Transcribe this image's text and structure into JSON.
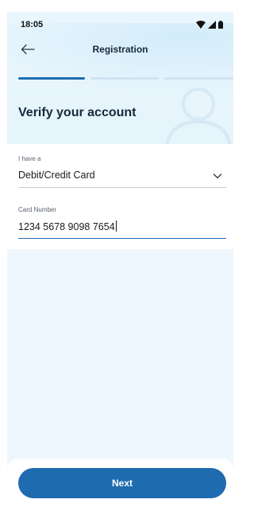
{
  "status_bar": {
    "time": "18:05"
  },
  "header": {
    "title": "Registration"
  },
  "progress": {
    "current_step": 1,
    "total_steps": 3
  },
  "page": {
    "heading": "Verify your account"
  },
  "form": {
    "card_type": {
      "label": "I have a",
      "value": "Debit/Credit Card"
    },
    "card_number": {
      "label": "Card Number",
      "value": "1234 5678 9098 7654"
    }
  },
  "footer": {
    "next_label": "Next"
  },
  "colors": {
    "accent": "#1e6bb0",
    "background": "#eef7fd"
  },
  "icons": [
    "back-arrow-icon",
    "wifi-icon",
    "signal-icon",
    "battery-icon",
    "chevron-down-icon",
    "person-illustration"
  ]
}
